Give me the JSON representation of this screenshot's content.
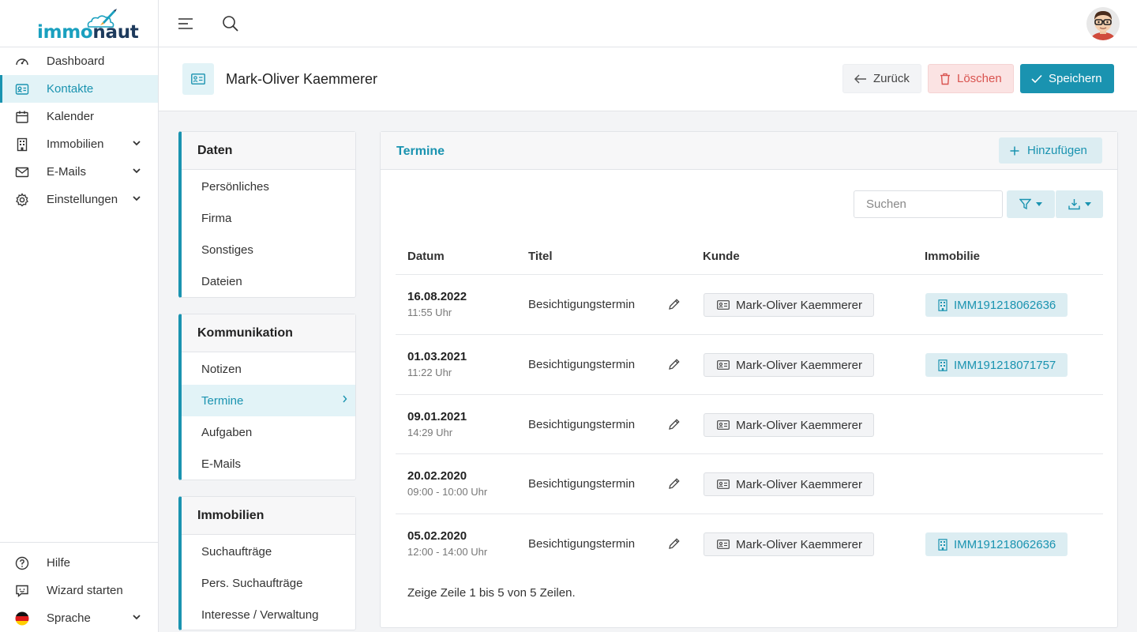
{
  "app": {
    "logo_part1": "immo",
    "logo_part2": "naut"
  },
  "sidebar": {
    "items": [
      {
        "label": "Dashboard",
        "icon": "gauge-icon"
      },
      {
        "label": "Kontakte",
        "icon": "contact-card-icon"
      },
      {
        "label": "Kalender",
        "icon": "calendar-icon"
      },
      {
        "label": "Immobilien",
        "icon": "building-icon"
      },
      {
        "label": "E-Mails",
        "icon": "mail-icon"
      },
      {
        "label": "Einstellungen",
        "icon": "gear-icon"
      }
    ],
    "bottom": [
      {
        "label": "Hilfe",
        "icon": "help-icon"
      },
      {
        "label": "Wizard starten",
        "icon": "wizard-icon"
      },
      {
        "label": "Sprache",
        "icon": "german-flag-icon"
      }
    ]
  },
  "header": {
    "title": "Mark-Oliver Kaemmerer",
    "back_label": "Zurück",
    "delete_label": "Löschen",
    "save_label": "Speichern"
  },
  "panels": {
    "daten": {
      "title": "Daten",
      "items": [
        "Persönliches",
        "Firma",
        "Sonstiges",
        "Dateien"
      ]
    },
    "kommunikation": {
      "title": "Kommunikation",
      "items": [
        "Notizen",
        "Termine",
        "Aufgaben",
        "E-Mails"
      ]
    },
    "immobilien": {
      "title": "Immobilien",
      "items": [
        "Suchaufträge",
        "Pers. Suchaufträge",
        "Interesse / Verwaltung"
      ]
    }
  },
  "termine": {
    "title": "Termine",
    "add_label": "Hinzufügen",
    "search_placeholder": "Suchen",
    "columns": {
      "datum": "Datum",
      "titel": "Titel",
      "kunde": "Kunde",
      "immobilie": "Immobilie"
    },
    "rows": [
      {
        "date": "16.08.2022",
        "time": "11:55 Uhr",
        "title": "Besichtigungstermin",
        "kunde": "Mark-Oliver Kaemmerer",
        "immobilie": "IMM191218062636"
      },
      {
        "date": "01.03.2021",
        "time": "11:22 Uhr",
        "title": "Besichtigungstermin",
        "kunde": "Mark-Oliver Kaemmerer",
        "immobilie": "IMM191218071757"
      },
      {
        "date": "09.01.2021",
        "time": "14:29 Uhr",
        "title": "Besichtigungstermin",
        "kunde": "Mark-Oliver Kaemmerer",
        "immobilie": ""
      },
      {
        "date": "20.02.2020",
        "time": "09:00 - 10:00 Uhr",
        "title": "Besichtigungstermin",
        "kunde": "Mark-Oliver Kaemmerer",
        "immobilie": ""
      },
      {
        "date": "05.02.2020",
        "time": "12:00 - 14:00 Uhr",
        "title": "Besichtigungstermin",
        "kunde": "Mark-Oliver Kaemmerer",
        "immobilie": "IMM191218062636"
      }
    ],
    "footer": "Zeige Zeile 1 bis 5 von 5 Zeilen."
  },
  "colors": {
    "accent": "#1a93b0",
    "danger": "#d9534f",
    "accent_light": "#e2f3f7"
  }
}
